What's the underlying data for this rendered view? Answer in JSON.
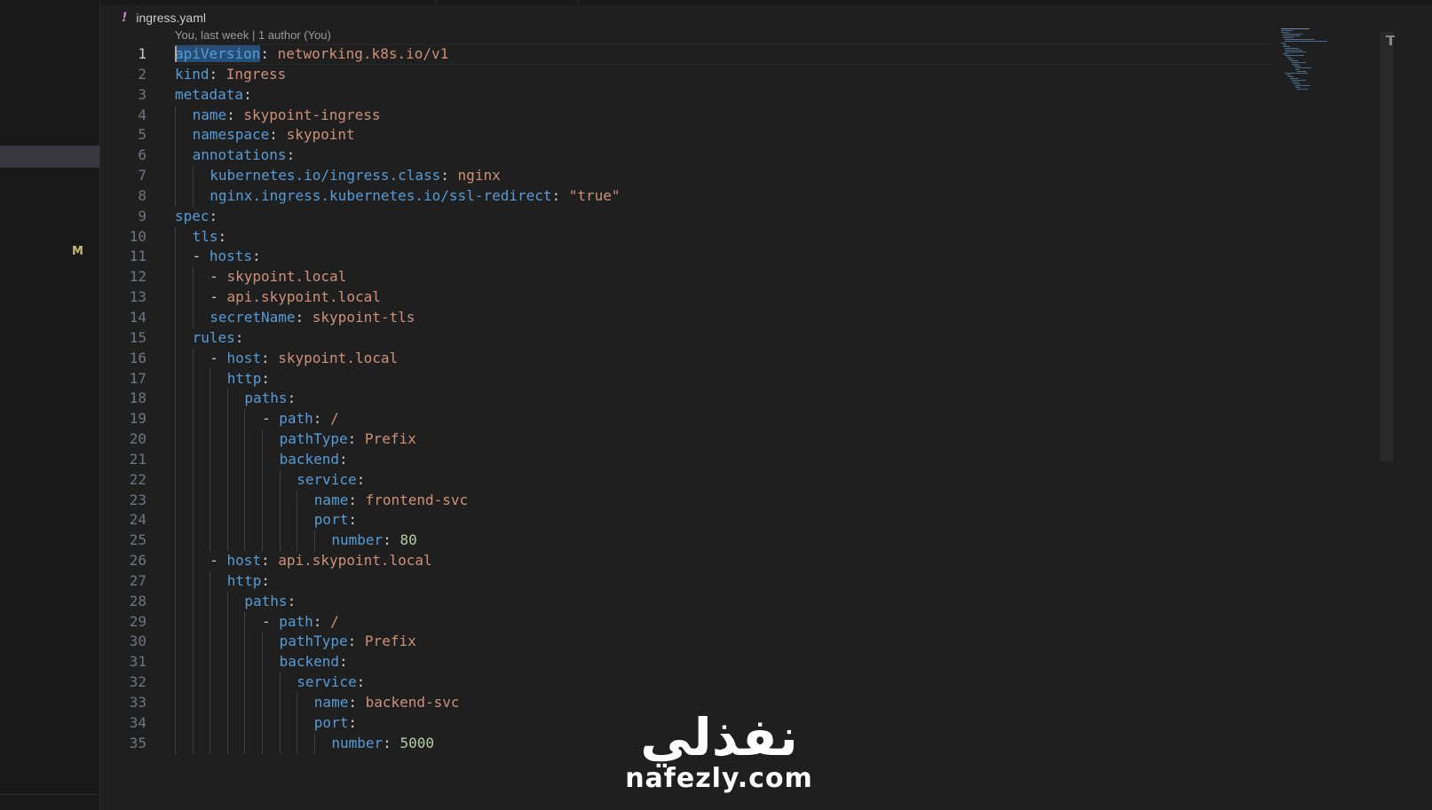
{
  "sidebar": {
    "modified_badge": "M"
  },
  "editor": {
    "breadcrumb": {
      "icon": "warning-exclamation-icon",
      "icon_glyph": "!",
      "file": "ingress.yaml"
    },
    "blame": "You, last week | 1 author (You)"
  },
  "code_lines": [
    {
      "n": "1",
      "indent": 0,
      "toks": [
        [
          "k",
          "apiVersion",
          "hl"
        ],
        [
          "p",
          ": "
        ],
        [
          "v",
          "networking.k8s.io/v1"
        ]
      ]
    },
    {
      "n": "2",
      "indent": 0,
      "toks": [
        [
          "k",
          "kind"
        ],
        [
          "p",
          ": "
        ],
        [
          "v",
          "Ingress"
        ]
      ]
    },
    {
      "n": "3",
      "indent": 0,
      "toks": [
        [
          "k",
          "metadata"
        ],
        [
          "p",
          ":"
        ]
      ]
    },
    {
      "n": "4",
      "indent": 1,
      "toks": [
        [
          "k",
          "name"
        ],
        [
          "p",
          ": "
        ],
        [
          "v",
          "skypoint-ingress"
        ]
      ]
    },
    {
      "n": "5",
      "indent": 1,
      "toks": [
        [
          "k",
          "namespace"
        ],
        [
          "p",
          ": "
        ],
        [
          "v",
          "skypoint"
        ]
      ]
    },
    {
      "n": "6",
      "indent": 1,
      "toks": [
        [
          "k",
          "annotations"
        ],
        [
          "p",
          ":"
        ]
      ]
    },
    {
      "n": "7",
      "indent": 2,
      "toks": [
        [
          "k",
          "kubernetes.io/ingress.class"
        ],
        [
          "p",
          ": "
        ],
        [
          "v",
          "nginx"
        ]
      ]
    },
    {
      "n": "8",
      "indent": 2,
      "toks": [
        [
          "k",
          "nginx.ingress.kubernetes.io/ssl-redirect"
        ],
        [
          "p",
          ": "
        ],
        [
          "v",
          "\"true\""
        ]
      ]
    },
    {
      "n": "9",
      "indent": 0,
      "toks": [
        [
          "k",
          "spec"
        ],
        [
          "p",
          ":"
        ]
      ]
    },
    {
      "n": "10",
      "indent": 1,
      "toks": [
        [
          "k",
          "tls"
        ],
        [
          "p",
          ":"
        ]
      ]
    },
    {
      "n": "11",
      "indent": 1,
      "toks": [
        [
          "p",
          "- "
        ],
        [
          "k",
          "hosts"
        ],
        [
          "p",
          ":"
        ]
      ]
    },
    {
      "n": "12",
      "indent": 2,
      "toks": [
        [
          "p",
          "- "
        ],
        [
          "v",
          "skypoint.local"
        ]
      ]
    },
    {
      "n": "13",
      "indent": 2,
      "toks": [
        [
          "p",
          "- "
        ],
        [
          "v",
          "api.skypoint.local"
        ]
      ]
    },
    {
      "n": "14",
      "indent": 2,
      "toks": [
        [
          "k",
          "secretName"
        ],
        [
          "p",
          ": "
        ],
        [
          "v",
          "skypoint-tls"
        ]
      ]
    },
    {
      "n": "15",
      "indent": 1,
      "toks": [
        [
          "k",
          "rules"
        ],
        [
          "p",
          ":"
        ]
      ]
    },
    {
      "n": "16",
      "indent": 2,
      "toks": [
        [
          "p",
          "- "
        ],
        [
          "k",
          "host"
        ],
        [
          "p",
          ": "
        ],
        [
          "v",
          "skypoint.local"
        ]
      ]
    },
    {
      "n": "17",
      "indent": 3,
      "toks": [
        [
          "k",
          "http"
        ],
        [
          "p",
          ":"
        ]
      ]
    },
    {
      "n": "18",
      "indent": 4,
      "toks": [
        [
          "k",
          "paths"
        ],
        [
          "p",
          ":"
        ]
      ]
    },
    {
      "n": "19",
      "indent": 5,
      "toks": [
        [
          "p",
          "- "
        ],
        [
          "k",
          "path"
        ],
        [
          "p",
          ": "
        ],
        [
          "v",
          "/"
        ]
      ]
    },
    {
      "n": "20",
      "indent": 6,
      "toks": [
        [
          "k",
          "pathType"
        ],
        [
          "p",
          ": "
        ],
        [
          "v",
          "Prefix"
        ]
      ]
    },
    {
      "n": "21",
      "indent": 6,
      "toks": [
        [
          "k",
          "backend"
        ],
        [
          "p",
          ":"
        ]
      ]
    },
    {
      "n": "22",
      "indent": 7,
      "toks": [
        [
          "k",
          "service"
        ],
        [
          "p",
          ":"
        ]
      ]
    },
    {
      "n": "23",
      "indent": 8,
      "toks": [
        [
          "k",
          "name"
        ],
        [
          "p",
          ": "
        ],
        [
          "v",
          "frontend-svc"
        ]
      ]
    },
    {
      "n": "24",
      "indent": 8,
      "toks": [
        [
          "k",
          "port"
        ],
        [
          "p",
          ":"
        ]
      ]
    },
    {
      "n": "25",
      "indent": 9,
      "toks": [
        [
          "k",
          "number"
        ],
        [
          "p",
          ": "
        ],
        [
          "n",
          "80"
        ]
      ]
    },
    {
      "n": "26",
      "indent": 2,
      "toks": [
        [
          "p",
          "- "
        ],
        [
          "k",
          "host"
        ],
        [
          "p",
          ": "
        ],
        [
          "v",
          "api.skypoint.local"
        ]
      ]
    },
    {
      "n": "27",
      "indent": 3,
      "toks": [
        [
          "k",
          "http"
        ],
        [
          "p",
          ":"
        ]
      ]
    },
    {
      "n": "28",
      "indent": 4,
      "toks": [
        [
          "k",
          "paths"
        ],
        [
          "p",
          ":"
        ]
      ]
    },
    {
      "n": "29",
      "indent": 5,
      "toks": [
        [
          "p",
          "- "
        ],
        [
          "k",
          "path"
        ],
        [
          "p",
          ": "
        ],
        [
          "v",
          "/"
        ]
      ]
    },
    {
      "n": "30",
      "indent": 6,
      "toks": [
        [
          "k",
          "pathType"
        ],
        [
          "p",
          ": "
        ],
        [
          "v",
          "Prefix"
        ]
      ]
    },
    {
      "n": "31",
      "indent": 6,
      "toks": [
        [
          "k",
          "backend"
        ],
        [
          "p",
          ":"
        ]
      ]
    },
    {
      "n": "32",
      "indent": 7,
      "toks": [
        [
          "k",
          "service"
        ],
        [
          "p",
          ":"
        ]
      ]
    },
    {
      "n": "33",
      "indent": 8,
      "toks": [
        [
          "k",
          "name"
        ],
        [
          "p",
          ": "
        ],
        [
          "v",
          "backend-svc"
        ]
      ]
    },
    {
      "n": "34",
      "indent": 8,
      "toks": [
        [
          "k",
          "port"
        ],
        [
          "p",
          ":"
        ]
      ]
    },
    {
      "n": "35",
      "indent": 9,
      "toks": [
        [
          "k",
          "number"
        ],
        [
          "p",
          ": "
        ],
        [
          "n",
          "5000"
        ]
      ]
    }
  ],
  "watermark": {
    "arabic": "نفذلي",
    "latin": "nafezly.com"
  }
}
